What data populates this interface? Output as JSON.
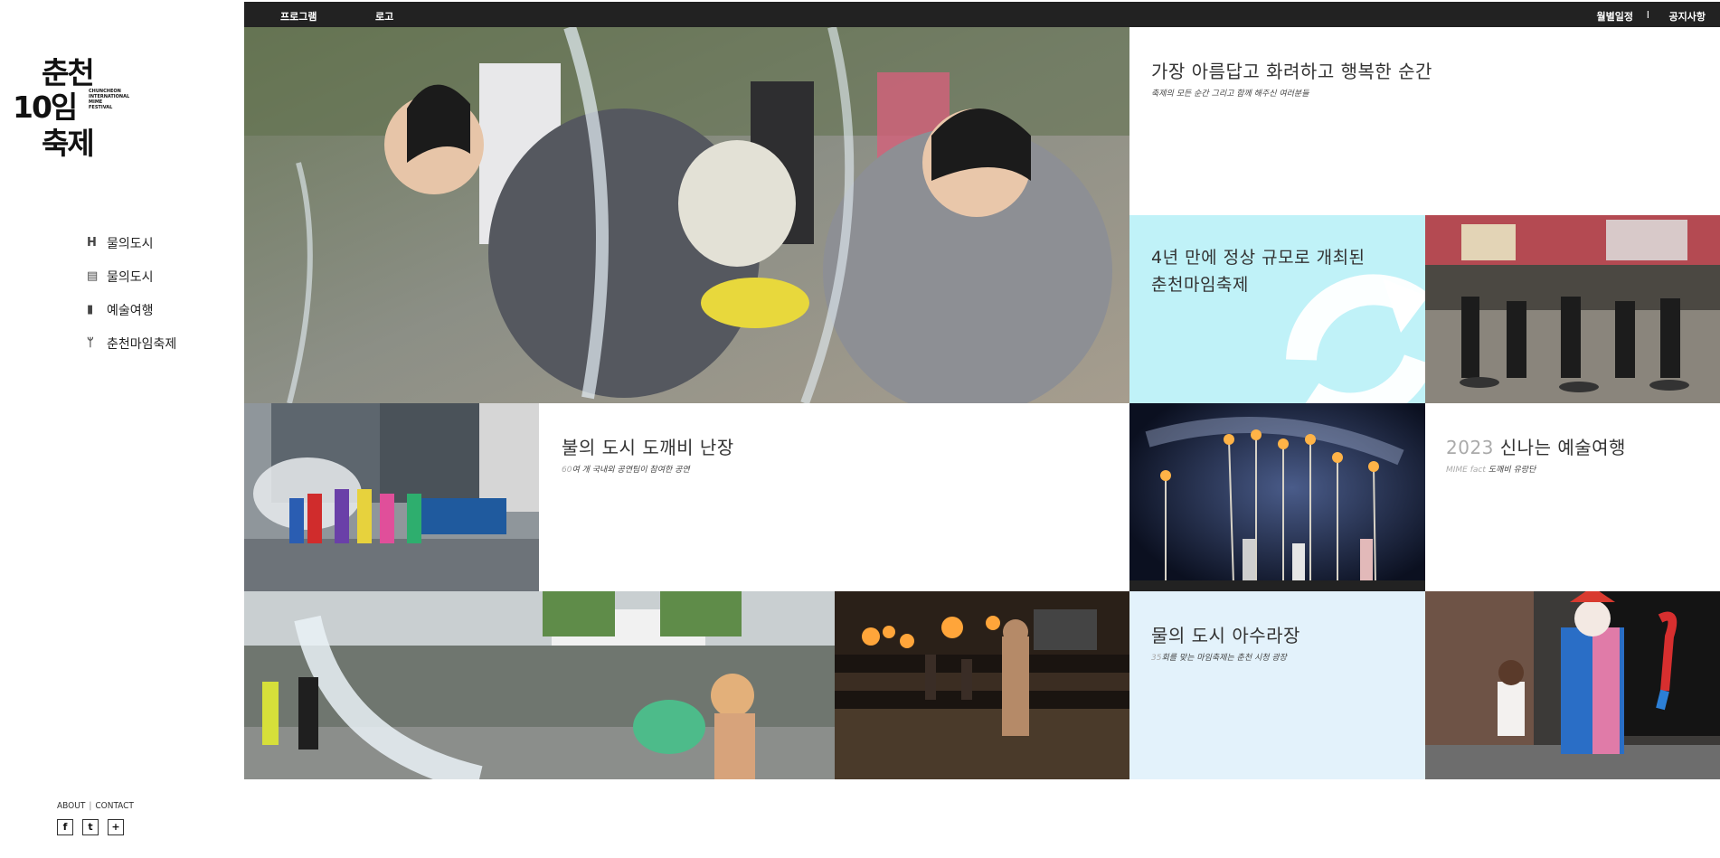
{
  "sidebar": {
    "logo": {
      "row1": "춘천",
      "row2": "10임",
      "row3": "축제",
      "eng_lines": [
        "CHUNCHEON",
        "INTERNATIONAL",
        "MIME",
        "FESTIVAL"
      ]
    },
    "nav": [
      {
        "icon": "h-icon",
        "glyph": "H",
        "label": "물의도시"
      },
      {
        "icon": "building-icon",
        "glyph": "▤",
        "label": "물의도시"
      },
      {
        "icon": "suitcase-icon",
        "glyph": "▮",
        "label": "예술여행"
      },
      {
        "icon": "utensils-icon",
        "glyph": "ᛘ",
        "label": "춘천마임축제"
      }
    ],
    "footer": {
      "about": "ABOUT",
      "sep": "|",
      "contact": "CONTACT"
    },
    "social": [
      {
        "icon": "facebook-icon",
        "glyph": "f"
      },
      {
        "icon": "twitter-icon",
        "glyph": "t"
      },
      {
        "icon": "plus-icon",
        "glyph": "+"
      }
    ]
  },
  "topbar": {
    "program": "프로그램",
    "logo": "로고",
    "schedule": "월별일정",
    "divider": "I",
    "notice": "공지사항",
    "bg_color": "#222222"
  },
  "tiles": {
    "t1": {
      "title": "가장 아름답고 화려하고 행복한 순간",
      "sub": "축제의 모든 순간 그리고 함께 해주신 여러분들"
    },
    "t2": {
      "title_line1": "4년 만에 정상 규모로 개최된",
      "title_line2": "춘천마임축제",
      "bg": "#c0f2f8"
    },
    "t3": {
      "title": "불의 도시 도깨비 난장",
      "sub_hl": "60",
      "sub": "여 개 국내외 공연팀이 참여한 공연"
    },
    "t4": {
      "title_hl": "2023",
      "title": "신나는 예술여행",
      "sub_hl": "MIME fact",
      "sub": "도깨비 유랑단"
    },
    "t5": {
      "title": "물의 도시 아수라장",
      "sub_hl": "35",
      "sub": "회를 맞는 마임축제는 춘천 시청 광장",
      "bg": "#e3f2fb"
    }
  },
  "photos": {
    "main": "water-fight-photo",
    "crowd": "mime-performers-crowd-photo",
    "street": "colorful-dancers-photo",
    "night": "night-fire-performance-photo",
    "water_bucket": "water-bucket-photo",
    "torches": "torch-procession-photo",
    "clown": "clown-balloon-photo"
  }
}
